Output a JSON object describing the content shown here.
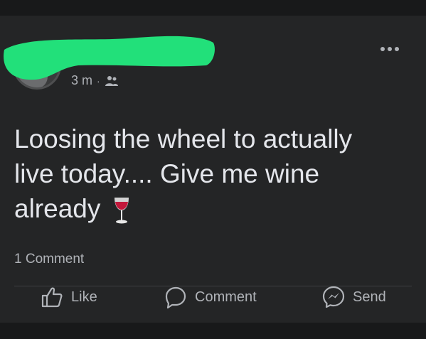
{
  "post": {
    "time": "3 m",
    "separator": "·",
    "audience_icon": "friends-icon",
    "text_line1": "Loosing the wheel to actually",
    "text_line2": "live today.... Give me wine",
    "text_line3": "already",
    "emoji": "wine-glass-icon"
  },
  "stats": {
    "comments": "1 Comment"
  },
  "actions": {
    "like": "Like",
    "comment": "Comment",
    "send": "Send"
  },
  "colors": {
    "redaction": "#22e07a",
    "background": "#242526",
    "text": "#e4e6eb",
    "secondary": "#b0b3b8"
  }
}
